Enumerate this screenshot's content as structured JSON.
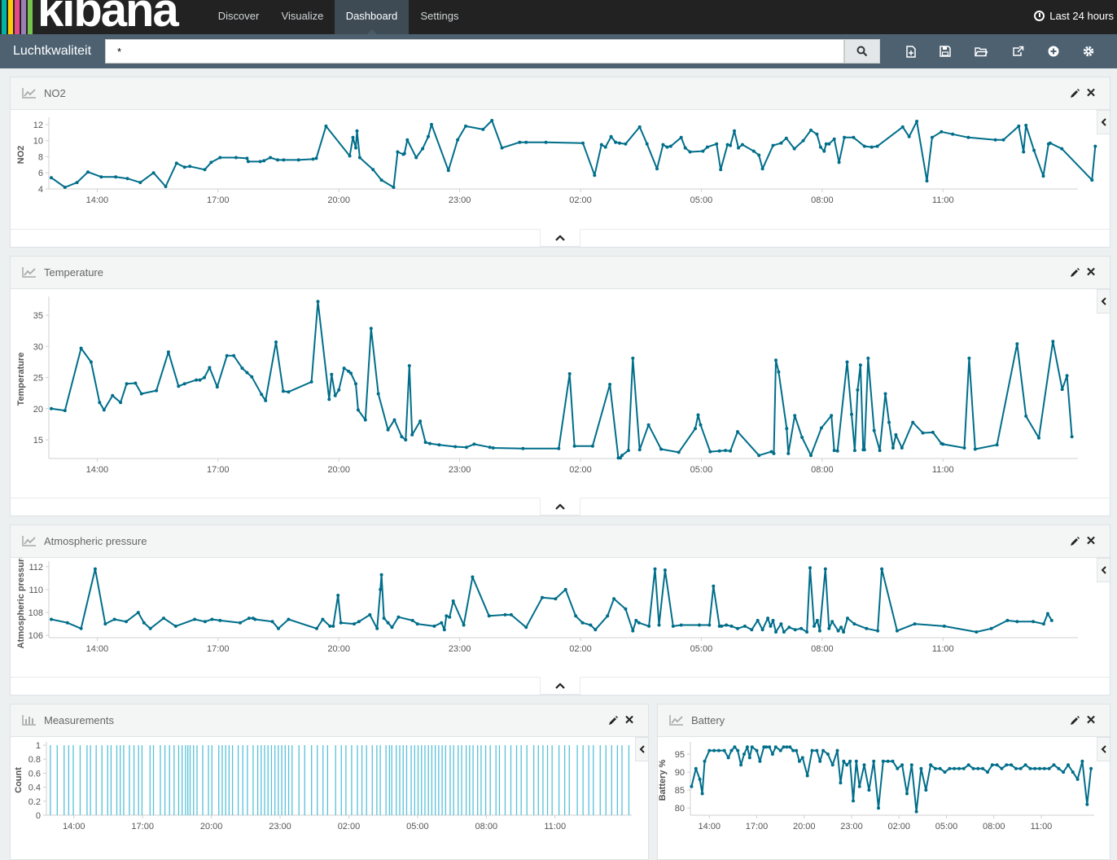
{
  "app": {
    "logo": "kibana",
    "logo_colors": [
      "#00b3a4",
      "#ffcb05",
      "#e8488b",
      "#9c7fb8",
      "#78c250"
    ],
    "nav": [
      "Discover",
      "Visualize",
      "Dashboard",
      "Settings"
    ],
    "active_nav": "Dashboard",
    "time_range": "Last 24 hours"
  },
  "toolbar": {
    "dashboard_title": "Luchtkwaliteit",
    "query": "*",
    "icons": [
      "new-dashboard-icon",
      "save-icon",
      "open-icon",
      "share-icon",
      "add-panel-icon",
      "settings-icon"
    ]
  },
  "colors": {
    "line": "#006e8a",
    "bar": "#57c1da",
    "axis": "#d0d0d0",
    "tick": "#888"
  },
  "panels": [
    {
      "title": "NO2",
      "icon": "line-chart-icon"
    },
    {
      "title": "Temperature",
      "icon": "line-chart-icon"
    },
    {
      "title": "Atmospheric pressure",
      "icon": "line-chart-icon"
    },
    {
      "title": "Measurements",
      "icon": "bar-chart-icon"
    },
    {
      "title": "Battery",
      "icon": "line-chart-icon"
    }
  ],
  "chart_data": [
    {
      "type": "line",
      "title": "NO2",
      "ylabel": "NO2",
      "ylim": [
        4,
        12.5
      ],
      "yticks": [
        4,
        6,
        8,
        10,
        12
      ],
      "xticks": [
        "14:00",
        "17:00",
        "20:00",
        "23:00",
        "02:00",
        "05:00",
        "08:00",
        "11:00"
      ],
      "x_hours": [
        12.86,
        13.2,
        13.5,
        13.77,
        14.1,
        14.46,
        14.75,
        15.07,
        15.4,
        15.7,
        15.97,
        16.17,
        16.3,
        16.67,
        16.83,
        17.05,
        17.45,
        17.72,
        17.75,
        18.05,
        18.14,
        18.3,
        18.48,
        18.63,
        19.0,
        19.36,
        19.44,
        19.68,
        20.27,
        20.35,
        20.42,
        20.45,
        20.52,
        20.85,
        21.06,
        21.36,
        21.46,
        21.6,
        21.63,
        21.7,
        21.92,
        22.08,
        22.22,
        22.3,
        22.72,
        22.95,
        23.15,
        23.58,
        23.8,
        24.05,
        24.49,
        24.65,
        25.14,
        26.06,
        26.35,
        26.52,
        26.62,
        26.76,
        26.87,
        26.97,
        27.12,
        27.47,
        27.65,
        27.9,
        28.05,
        28.15,
        28.24,
        28.5,
        28.6,
        28.72,
        29.04,
        29.15,
        29.38,
        29.48,
        29.65,
        29.72,
        29.82,
        29.92,
        30.02,
        30.3,
        30.43,
        30.52,
        30.78,
        30.98,
        31.11,
        31.31,
        31.53,
        31.72,
        31.87,
        31.96,
        32.05,
        32.1,
        32.17,
        32.3,
        32.42,
        32.55,
        32.78,
        33.05,
        33.23,
        33.37,
        34.0,
        34.16,
        34.35,
        34.6,
        34.73,
        34.96,
        35.24,
        35.63,
        36.3,
        36.5,
        36.88,
        37.0,
        37.06,
        37.26,
        37.49,
        37.62,
        37.66,
        37.95,
        38.7,
        38.78
      ],
      "values": [
        5.4,
        4.2,
        4.8,
        6.1,
        5.5,
        5.5,
        5.3,
        4.8,
        6.0,
        4.3,
        7.2,
        6.7,
        6.8,
        6.4,
        7.3,
        7.9,
        7.9,
        7.8,
        7.4,
        7.4,
        7.5,
        7.9,
        7.6,
        7.6,
        7.6,
        7.7,
        7.8,
        11.8,
        8.1,
        10.4,
        9.1,
        11.2,
        7.9,
        6.4,
        5.1,
        4.2,
        8.6,
        8.3,
        8.4,
        10.1,
        7.9,
        9.0,
        10.5,
        12.0,
        6.3,
        10.1,
        11.8,
        11.4,
        12.5,
        9.1,
        9.8,
        9.8,
        9.8,
        9.7,
        5.7,
        9.5,
        9.2,
        10.5,
        9.8,
        9.7,
        9.6,
        11.7,
        9.6,
        6.5,
        9.5,
        9.2,
        9.3,
        10.4,
        9.1,
        8.6,
        8.7,
        9.2,
        9.6,
        6.4,
        9.5,
        9.4,
        11.2,
        9.1,
        9.5,
        8.7,
        8.2,
        6.5,
        9.4,
        9.7,
        10.3,
        9.0,
        10.0,
        11.3,
        10.8,
        9.2,
        8.7,
        9.6,
        9.6,
        10.2,
        7.3,
        10.4,
        10.4,
        9.3,
        9.2,
        9.3,
        11.7,
        10.5,
        12.4,
        5.0,
        10.4,
        11.1,
        10.8,
        10.4,
        10.1,
        10.1,
        11.8,
        8.6,
        11.9,
        8.8,
        5.6,
        9.6,
        9.7,
        9.0,
        5.1,
        9.3
      ]
    },
    {
      "type": "line",
      "title": "Temperature",
      "ylabel": "Temperature",
      "ylim": [
        12,
        37.5
      ],
      "yticks": [
        15,
        20,
        25,
        30,
        35
      ],
      "xticks": [
        "14:00",
        "17:00",
        "20:00",
        "23:00",
        "02:00",
        "05:00",
        "08:00",
        "11:00"
      ],
      "x_hours": [
        12.86,
        13.2,
        13.6,
        13.85,
        14.06,
        14.17,
        14.38,
        14.58,
        14.73,
        14.95,
        15.1,
        15.47,
        15.77,
        16.02,
        16.17,
        16.46,
        16.55,
        16.66,
        16.79,
        16.98,
        17.22,
        17.39,
        17.6,
        17.72,
        17.84,
        18.08,
        18.18,
        18.44,
        18.62,
        18.75,
        19.32,
        19.48,
        19.76,
        19.82,
        19.91,
        20.0,
        20.13,
        20.24,
        20.3,
        20.42,
        20.48,
        20.66,
        20.8,
        20.98,
        21.22,
        21.38,
        21.56,
        21.66,
        21.75,
        21.82,
        22.02,
        22.15,
        22.26,
        22.49,
        22.89,
        23.17,
        23.36,
        23.75,
        23.83,
        24.57,
        25.46,
        25.73,
        25.85,
        26.3,
        26.73,
        26.94,
        26.99,
        27.03,
        27.19,
        27.3,
        27.47,
        27.69,
        28.0,
        28.44,
        28.85,
        28.92,
        28.98,
        29.22,
        29.45,
        29.6,
        29.72,
        29.9,
        30.43,
        30.74,
        30.8,
        30.85,
        30.92,
        31.12,
        31.16,
        31.32,
        31.5,
        31.72,
        31.98,
        32.23,
        32.3,
        32.38,
        32.62,
        32.73,
        32.81,
        32.88,
        32.95,
        33.02,
        33.05,
        33.14,
        33.29,
        33.43,
        33.57,
        33.66,
        33.76,
        33.83,
        33.98,
        34.25,
        34.5,
        34.75,
        34.96,
        35.0,
        35.53,
        35.65,
        35.8,
        36.34,
        36.84,
        37.06,
        37.38,
        37.73,
        37.96,
        38.08,
        38.2
      ],
      "values": [
        20.0,
        19.7,
        29.7,
        27.5,
        21.0,
        19.8,
        22.1,
        21.0,
        24.0,
        24.1,
        22.4,
        22.9,
        29.1,
        23.6,
        24.0,
        24.6,
        24.6,
        25.0,
        26.6,
        23.5,
        28.5,
        28.5,
        26.5,
        25.8,
        25.1,
        22.3,
        21.3,
        30.7,
        22.8,
        22.7,
        24.3,
        37.2,
        21.5,
        25.5,
        22.1,
        23.0,
        26.5,
        26.0,
        25.7,
        24.0,
        19.8,
        18.2,
        32.9,
        22.4,
        16.6,
        18.2,
        15.5,
        15.0,
        26.9,
        15.8,
        18.0,
        14.6,
        14.4,
        14.2,
        13.9,
        13.8,
        14.3,
        13.8,
        13.7,
        13.6,
        13.6,
        25.6,
        14.0,
        14.0,
        23.9,
        12.1,
        12.1,
        12.5,
        13.3,
        28.1,
        13.4,
        17.4,
        13.5,
        13.0,
        16.8,
        19.0,
        17.4,
        13.1,
        13.2,
        13.3,
        13.2,
        16.3,
        12.5,
        13.1,
        12.8,
        27.8,
        25.9,
        16.8,
        12.8,
        18.9,
        15.4,
        12.5,
        16.9,
        18.9,
        13.3,
        13.2,
        27.5,
        19.1,
        13.3,
        23.0,
        27.0,
        13.4,
        13.4,
        28.1,
        16.5,
        13.3,
        22.4,
        17.8,
        13.7,
        15.8,
        13.7,
        17.8,
        16.1,
        16.2,
        14.4,
        14.3,
        13.7,
        28.1,
        13.5,
        14.2,
        30.4,
        18.8,
        15.3,
        30.8,
        23.1,
        25.3,
        15.5,
        15.0,
        14.0
      ]
    },
    {
      "type": "line",
      "title": "Atmospheric pressure",
      "ylabel": "Atmospheric pressure",
      "ylim": [
        105.8,
        112.2
      ],
      "yticks": [
        106,
        108,
        110,
        112
      ],
      "xticks": [
        "14:00",
        "17:00",
        "20:00",
        "23:00",
        "02:00",
        "05:00",
        "08:00",
        "11:00"
      ],
      "x_hours": [
        12.86,
        13.26,
        13.6,
        13.95,
        14.2,
        14.43,
        14.72,
        15.02,
        15.16,
        15.32,
        15.65,
        15.95,
        16.42,
        16.68,
        16.85,
        17.05,
        17.55,
        17.77,
        17.87,
        17.92,
        18.35,
        18.5,
        18.75,
        19.45,
        19.6,
        19.78,
        19.86,
        19.98,
        20.05,
        20.38,
        20.5,
        20.77,
        20.95,
        21.03,
        21.06,
        21.12,
        21.22,
        21.32,
        21.48,
        21.83,
        21.95,
        22.37,
        22.55,
        22.62,
        22.67,
        22.75,
        22.84,
        23.1,
        23.32,
        23.73,
        24.13,
        24.28,
        24.65,
        25.05,
        25.38,
        25.63,
        25.88,
        26.05,
        26.25,
        26.37,
        26.67,
        26.83,
        27.12,
        27.3,
        27.38,
        27.45,
        27.7,
        27.85,
        27.95,
        28.1,
        28.3,
        28.5,
        28.95,
        29.2,
        29.3,
        29.45,
        29.5,
        29.62,
        29.75,
        29.9,
        30.08,
        30.25,
        30.4,
        30.52,
        30.65,
        30.72,
        30.78,
        30.85,
        30.98,
        31.05,
        31.18,
        31.33,
        31.48,
        31.62,
        31.7,
        31.8,
        31.88,
        31.94,
        32.08,
        32.17,
        32.25,
        32.4,
        32.47,
        32.53,
        32.63,
        32.8,
        33.1,
        33.38,
        33.48,
        33.86,
        34.3,
        35.03,
        35.83,
        36.2,
        36.6,
        36.84,
        37.24,
        37.5,
        37.6,
        37.7
      ],
      "values": [
        107.4,
        107.1,
        106.6,
        111.8,
        107.0,
        107.4,
        107.2,
        108.0,
        107.1,
        106.6,
        107.5,
        106.8,
        107.4,
        107.2,
        107.4,
        107.3,
        107.1,
        107.5,
        107.5,
        107.4,
        107.2,
        106.6,
        107.4,
        106.6,
        107.4,
        106.8,
        106.8,
        109.5,
        107.1,
        107.0,
        107.2,
        107.8,
        106.6,
        110.0,
        111.3,
        107.5,
        107.1,
        106.7,
        107.6,
        107.3,
        107.0,
        106.8,
        107.1,
        106.5,
        107.7,
        107.6,
        109.0,
        106.9,
        111.1,
        107.7,
        107.8,
        107.8,
        106.7,
        109.3,
        109.2,
        110.0,
        107.7,
        107.1,
        106.9,
        106.5,
        107.7,
        109.2,
        108.3,
        106.4,
        107.3,
        107.1,
        106.8,
        111.8,
        106.9,
        111.7,
        106.8,
        106.9,
        106.9,
        106.9,
        110.3,
        106.8,
        106.8,
        106.9,
        106.8,
        106.6,
        106.8,
        106.5,
        107.3,
        106.5,
        107.5,
        106.8,
        107.3,
        106.3,
        107.0,
        106.3,
        106.7,
        106.5,
        106.6,
        106.3,
        111.9,
        106.8,
        107.3,
        106.4,
        111.8,
        106.6,
        107.2,
        106.4,
        106.7,
        106.3,
        107.5,
        107.0,
        106.6,
        106.4,
        111.8,
        106.4,
        107.0,
        106.8,
        106.3,
        106.6,
        107.3,
        107.2,
        107.2,
        107.0,
        107.9,
        107.3,
        106.4,
        110.4,
        107.6,
        107.3,
        107.3
      ]
    },
    {
      "type": "bar",
      "title": "Measurements",
      "ylabel": "Count",
      "ylim": [
        0,
        1
      ],
      "yticks": [
        "0",
        "0.2",
        "0.4",
        "0.6",
        "0.8",
        "1"
      ],
      "xticks": [
        "14:00",
        "17:00",
        "20:00",
        "23:00",
        "02:00",
        "05:00",
        "08:00",
        "11:00"
      ],
      "x_hours": [
        12.95,
        13.25,
        13.55,
        13.75,
        13.95,
        14.25,
        14.55,
        14.7,
        14.95,
        15.2,
        15.45,
        15.6,
        15.85,
        16.0,
        16.15,
        16.4,
        16.6,
        16.8,
        16.95,
        17.3,
        17.45,
        17.75,
        17.95,
        18.15,
        18.35,
        18.55,
        18.7,
        18.85,
        18.95,
        19.05,
        19.2,
        19.35,
        19.6,
        19.85,
        20.0,
        20.3,
        20.45,
        20.6,
        20.75,
        20.9,
        21.15,
        21.35,
        21.55,
        21.8,
        22.0,
        22.15,
        22.3,
        22.45,
        22.6,
        22.75,
        22.9,
        23.05,
        23.2,
        23.35,
        23.5,
        23.8,
        24.05,
        24.35,
        24.6,
        24.85,
        25.05,
        25.4,
        25.65,
        25.85,
        26.1,
        26.35,
        26.55,
        26.75,
        27.0,
        27.2,
        27.35,
        27.6,
        27.75,
        27.85,
        28.05,
        28.2,
        28.35,
        28.5,
        28.7,
        28.85,
        29.0,
        29.15,
        29.3,
        29.45,
        29.6,
        29.75,
        29.9,
        30.05,
        30.2,
        30.4,
        30.55,
        30.75,
        30.9,
        31.1,
        31.25,
        31.4,
        31.6,
        31.75,
        31.95,
        32.15,
        32.4,
        32.55,
        32.8,
        33.05,
        33.3,
        33.5,
        33.75,
        34.05,
        34.25,
        34.45,
        34.65,
        34.85,
        35.15,
        35.4,
        35.6,
        35.95,
        36.2,
        36.45,
        36.65,
        36.95,
        37.2,
        37.45,
        37.7,
        37.9,
        38.2
      ],
      "values": [
        1
      ]
    },
    {
      "type": "line",
      "title": "Battery",
      "ylabel": "Battery %",
      "ylim": [
        78,
        97.5
      ],
      "yticks": [
        80,
        85,
        90,
        95
      ],
      "xticks": [
        "14:00",
        "17:00",
        "20:00",
        "23:00",
        "02:00",
        "05:00",
        "08:00",
        "11:00"
      ],
      "x_hours": [
        12.87,
        13.15,
        13.4,
        13.55,
        13.7,
        14.0,
        14.3,
        14.6,
        14.95,
        15.2,
        15.4,
        15.6,
        15.8,
        16.0,
        16.2,
        16.4,
        16.55,
        16.7,
        17.0,
        17.2,
        17.45,
        17.6,
        17.8,
        18.0,
        18.2,
        18.5,
        18.7,
        18.9,
        19.1,
        19.3,
        19.5,
        19.7,
        19.9,
        20.2,
        20.5,
        20.8,
        21.0,
        21.2,
        21.5,
        21.8,
        22.1,
        22.3,
        22.5,
        22.7,
        22.9,
        23.1,
        23.3,
        23.5,
        23.8,
        24.1,
        24.4,
        24.7,
        25.0,
        25.3,
        25.6,
        25.9,
        26.2,
        26.5,
        26.8,
        27.1,
        27.4,
        27.7,
        28.0,
        28.3,
        28.6,
        28.9,
        29.2,
        29.5,
        29.8,
        30.1,
        30.4,
        30.7,
        31.0,
        31.3,
        31.6,
        31.9,
        32.2,
        32.5,
        32.8,
        33.1,
        33.4,
        33.7,
        34.0,
        34.3,
        34.6,
        34.9,
        35.2,
        35.5,
        35.8,
        36.1,
        36.4,
        36.7,
        37.0,
        37.3,
        37.6,
        37.9,
        38.15
      ],
      "values": [
        86,
        91,
        88,
        84,
        93,
        96,
        96,
        96,
        96,
        94,
        96,
        97,
        96,
        92,
        95,
        97,
        94,
        97,
        96,
        93,
        97,
        97,
        97,
        95,
        97,
        96,
        97,
        97,
        97,
        96,
        96,
        93,
        94,
        89,
        96,
        96,
        93,
        96,
        95,
        92,
        96,
        87,
        93,
        92,
        93,
        82,
        93,
        86,
        92,
        85,
        93,
        80,
        93,
        93,
        93,
        91,
        92,
        84,
        92,
        79,
        91,
        85,
        92,
        91,
        91,
        90,
        91,
        91,
        91,
        91,
        92,
        91,
        91,
        91,
        90,
        92,
        92,
        91,
        92,
        92,
        91,
        91,
        92,
        91,
        91,
        91,
        91,
        91,
        92,
        91,
        90,
        92,
        90,
        88,
        93,
        81,
        91
      ]
    }
  ]
}
